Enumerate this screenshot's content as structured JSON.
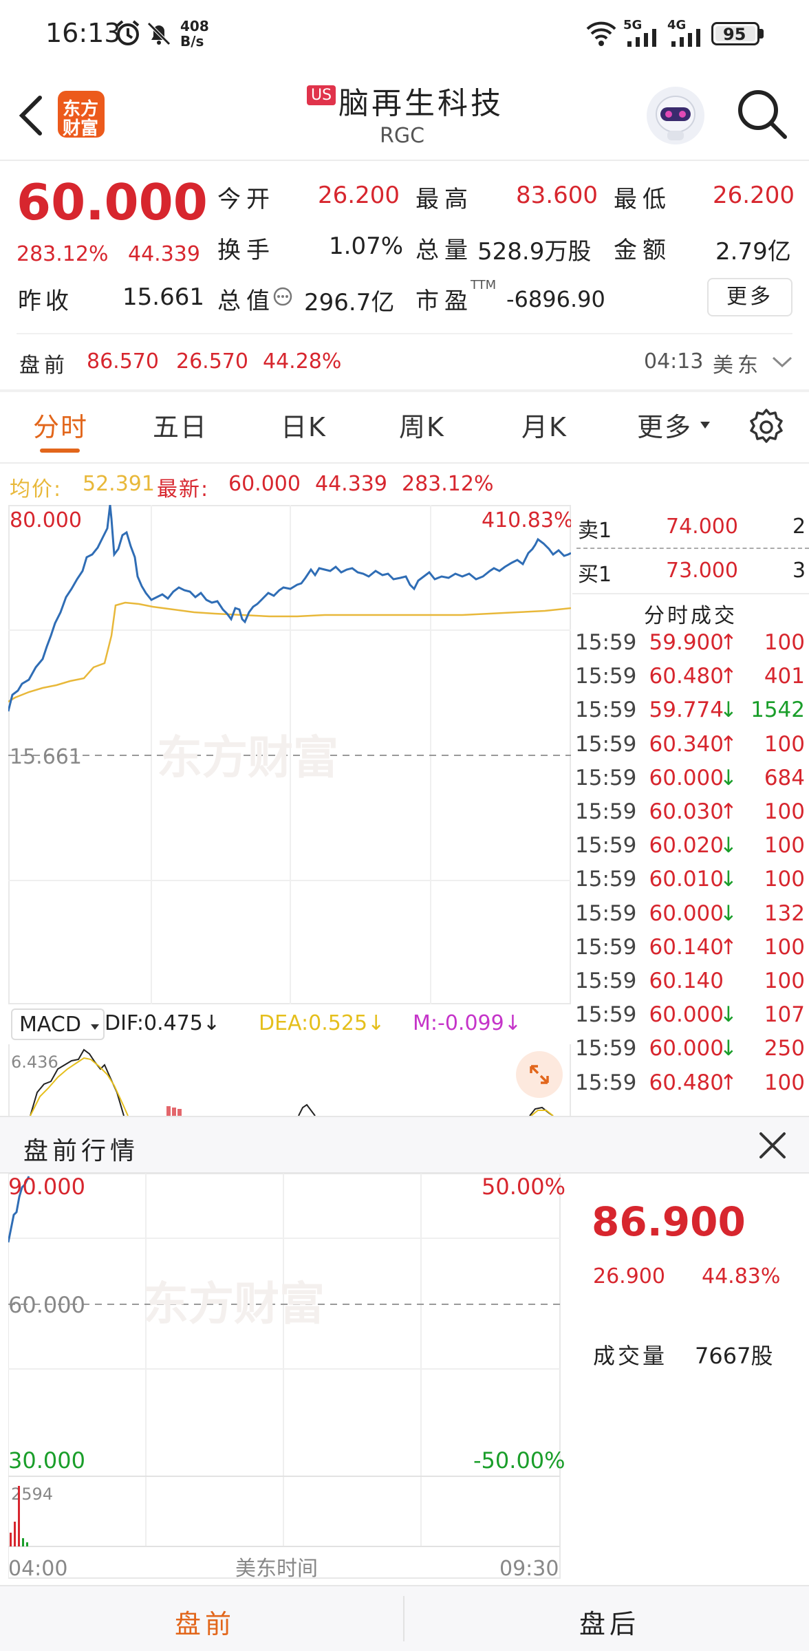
{
  "status_bar": {
    "time": "16:13",
    "net_speed": "408\nB/s",
    "net_speed_top": "408",
    "net_speed_bottom": "B/s",
    "signal_5g": "5G",
    "signal_4g": "4G",
    "battery": "95"
  },
  "header": {
    "logo_line1": "东方",
    "logo_line2": "财富",
    "market_badge": "US",
    "stock_name": "脑再生科技",
    "ticker": "RGC"
  },
  "quote": {
    "price": "60.000",
    "change_pct": "283.12%",
    "change": "44.339",
    "open_label": "今开",
    "open": "26.200",
    "high_label": "最高",
    "high": "83.600",
    "low_label": "最低",
    "low": "26.200",
    "turnover_label": "换手",
    "turnover": "1.07%",
    "volume_label": "总量",
    "volume": "528.9万股",
    "amount_label": "金额",
    "amount": "2.79亿",
    "prev_close_label": "昨收",
    "prev_close": "15.661",
    "mktcap_label": "总值",
    "mktcap": "296.7亿",
    "pe_label": "市盈",
    "pe_sup": "TTM",
    "pe": "-6896.90",
    "more_button": "更多"
  },
  "premarket_line": {
    "label": "盘前",
    "price": "86.570",
    "change": "26.570",
    "change_pct": "44.28%",
    "time": "04:13",
    "tz": "美东"
  },
  "tabs": [
    "分时",
    "五日",
    "日K",
    "周K",
    "月K",
    "更多"
  ],
  "info_line": {
    "avg_label": "均价:",
    "avg": "52.391",
    "last_label": "最新:",
    "last": "60.000",
    "change": "44.339",
    "change_pct": "283.12%"
  },
  "intraday_chart": {
    "y_top_label": "80.000",
    "pct_top_label": "410.83%",
    "prev_close_label": "15.661",
    "watermark": "东方财富"
  },
  "order_book": {
    "sell1_label": "卖1",
    "sell1_price": "74.000",
    "sell1_qty": "2",
    "buy1_label": "买1",
    "buy1_price": "73.000",
    "buy1_qty": "3",
    "trades_title": "分时成交"
  },
  "trades": [
    {
      "time": "15:59",
      "price": "59.900",
      "dir": "up",
      "vol": "100"
    },
    {
      "time": "15:59",
      "price": "60.480",
      "dir": "up",
      "vol": "401"
    },
    {
      "time": "15:59",
      "price": "59.774",
      "dir": "down",
      "vol": "1542"
    },
    {
      "time": "15:59",
      "price": "60.340",
      "dir": "up",
      "vol": "100"
    },
    {
      "time": "15:59",
      "price": "60.000",
      "dir": "down",
      "vol": "684"
    },
    {
      "time": "15:59",
      "price": "60.030",
      "dir": "up",
      "vol": "100"
    },
    {
      "time": "15:59",
      "price": "60.020",
      "dir": "down",
      "vol": "100"
    },
    {
      "time": "15:59",
      "price": "60.010",
      "dir": "down",
      "vol": "100"
    },
    {
      "time": "15:59",
      "price": "60.000",
      "dir": "down",
      "vol": "132"
    },
    {
      "time": "15:59",
      "price": "60.140",
      "dir": "up",
      "vol": "100"
    },
    {
      "time": "15:59",
      "price": "60.140",
      "dir": "none",
      "vol": "100"
    },
    {
      "time": "15:59",
      "price": "60.000",
      "dir": "down",
      "vol": "107"
    },
    {
      "time": "15:59",
      "price": "60.000",
      "dir": "down",
      "vol": "250"
    },
    {
      "time": "15:59",
      "price": "60.480",
      "dir": "up",
      "vol": "100"
    }
  ],
  "macd": {
    "selector": "MACD",
    "dif": "DIF:0.475↓",
    "dea": "DEA:0.525↓",
    "m": "M:-0.099↓",
    "top_value": "6.436"
  },
  "premarket_panel": {
    "title": "盘前行情",
    "y_top": "90.000",
    "pct_top": "50.00%",
    "y_mid": "60.000",
    "y_bottom": "30.000",
    "pct_bottom": "-50.00%",
    "vol_max": "2594",
    "x_start": "04:00",
    "x_mid": "美东时间",
    "x_end": "09:30",
    "price": "86.900",
    "change": "26.900",
    "change_pct": "44.83%",
    "volume_label": "成交量",
    "volume": "7667股",
    "watermark": "东方财富"
  },
  "bottom_tabs": {
    "pre": "盘前",
    "post": "盘后"
  },
  "colors": {
    "up": "#d7262e",
    "down": "#1a9e2a",
    "accent": "#e2661b",
    "price_line": "#2f6db5",
    "avg_line": "#e8b83a"
  }
}
